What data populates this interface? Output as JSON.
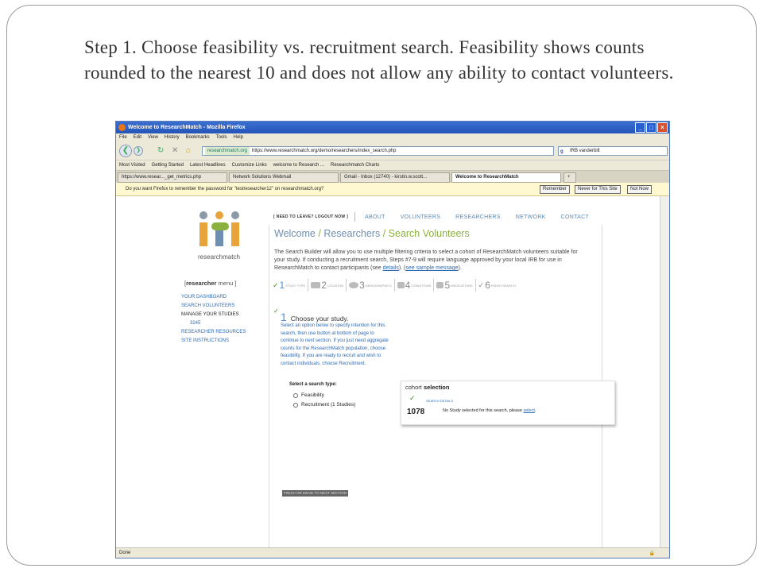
{
  "slide": {
    "text": "Step 1.  Choose feasibility vs. recruitment search.  Feasibility shows counts rounded to the nearest 10 and does not allow any ability to contact volunteers."
  },
  "browser": {
    "title": "Welcome to ResearchMatch - Mozilla Firefox",
    "menu": [
      "File",
      "Edit",
      "View",
      "History",
      "Bookmarks",
      "Tools",
      "Help"
    ],
    "site_label": "researchmatch.org",
    "url": "https://www.researchmatch.org/demo/researchers/index_search.php",
    "search_value": "IRB vanderbilt",
    "bookmarks": [
      "Most Visited",
      "Getting Started",
      "Latest Headlines",
      "Customize Links",
      "welcome to Research ...",
      "Researchmatch Charts"
    ],
    "tabs": [
      "https://www.resear..._get_metrics.php",
      "Network Solutions Webmail",
      "Gmail - Inbox (12740) - kirstin.w.scott...",
      "Welcome to ResearchMatch"
    ],
    "new_tab": "+",
    "notification": "Do you want Firefox to remember the password for \"testresearcher12\" on researchmatch.org?",
    "notify_buttons": {
      "remember": "Remember",
      "never": "Never for This Site",
      "not_now": "Not Now"
    },
    "status": "Done"
  },
  "page": {
    "logo_text": "researchmatch",
    "logo_watermark": "DEMO",
    "need_to_leave": "[ NEED TO LEAVE? LOGOUT NOW ]",
    "nav": [
      "ABOUT",
      "VOLUNTEERS",
      "RESEARCHERS",
      "NETWORK",
      "CONTACT"
    ],
    "crumbs": {
      "welcome": "Welcome",
      "sep": "/",
      "researchers": "Researchers",
      "current": "Search Volunteers"
    },
    "intro": {
      "part1": "The Search Builder will allow you to use multiple filtering criteria to select a cohort of ResearchMatch volunteers suitable for your study. If conducting a recruitment search, Steps #7-9 will require language approved by your local IRB for use in ResearchMatch to contact participants (see ",
      "details": "details",
      "part2": "). (",
      "sample": "see sample message",
      "part3": ")."
    },
    "sidebar": {
      "header_bracket_open": "[",
      "header_bold": "researcher",
      "header_rest": " menu ]",
      "items": [
        "YOUR DASHBOARD",
        "SEARCH VOLUNTEERS",
        "MANAGE YOUR STUDIES",
        "3245",
        "RESEARCHER RESOURCES",
        "SITE INSTRUCTIONS"
      ]
    },
    "steps": [
      {
        "num": "1",
        "label": "STUDY TYPE"
      },
      {
        "num": "2",
        "label": "LOCATION"
      },
      {
        "num": "3",
        "label": "DEMOGRAPHICS"
      },
      {
        "num": "4",
        "label": "CONDITIONS"
      },
      {
        "num": "5",
        "label": "MEDICATIONS"
      },
      {
        "num": "6",
        "label": "FINISH SEARCH"
      }
    ],
    "step_title_num": "1",
    "step_title": "Choose your study.",
    "step_desc": "Select an option below to specify intention for this search, then use button at bottom of page to continue to next section.  If you just need aggregate counts for the ResearchMatch population, choose feasibility. If you are ready to recruit and wish to contact individuals, choose Recruitment.",
    "select_label": "Select a search type:",
    "options": [
      "Feasibility",
      "Recruitment (1 Studies)"
    ],
    "finish_button": "FINISH OR MOVE TO NEXT SECTION",
    "cohort": {
      "title_plain": "cohort ",
      "title_bold": "selection",
      "search_details": "SEARCH DETAILS",
      "count": "1078",
      "message": "No Study selected for this search, please ",
      "link": "select",
      "period": "."
    }
  }
}
